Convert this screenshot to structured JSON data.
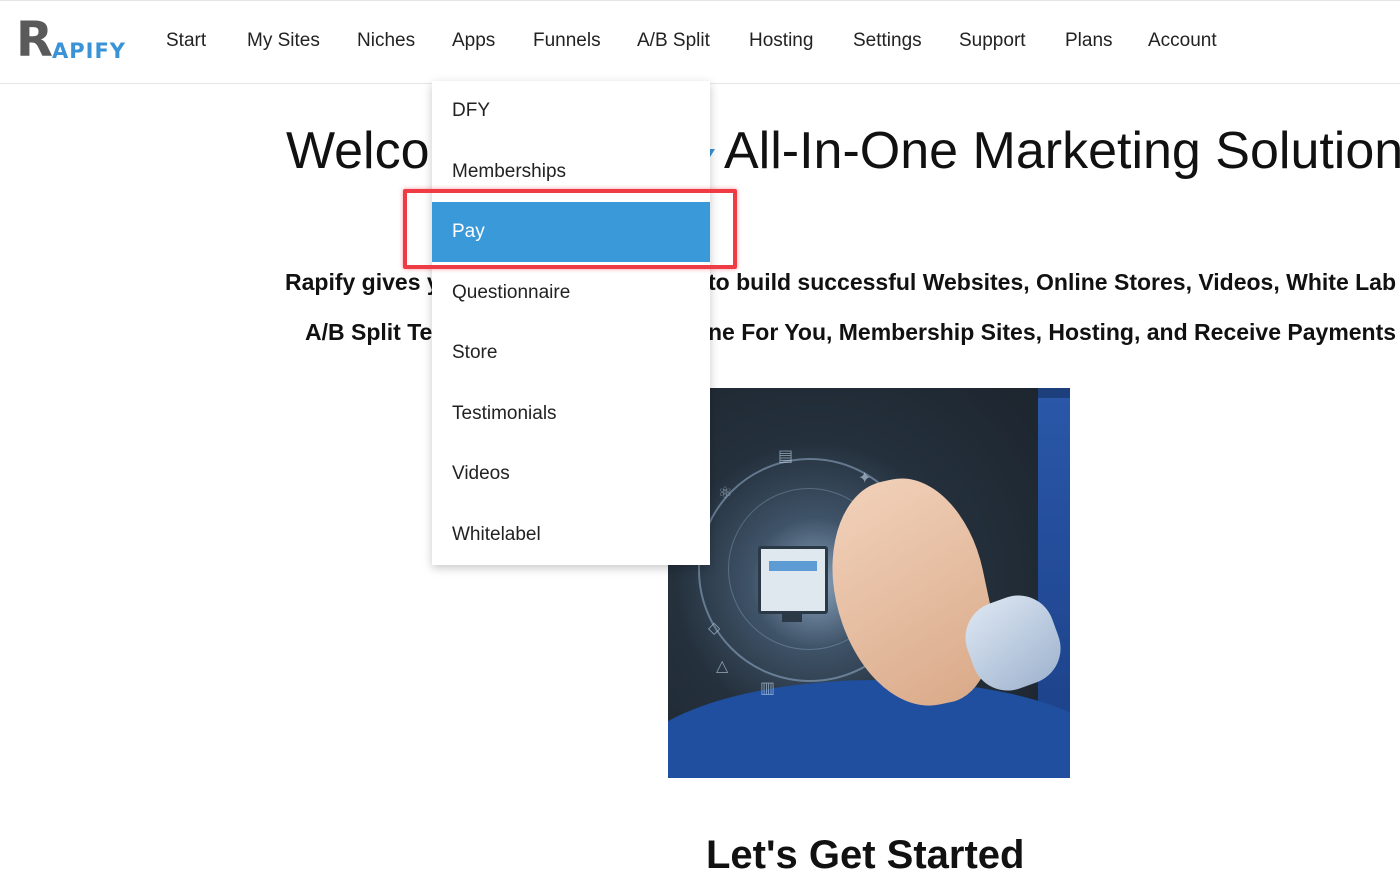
{
  "brand": {
    "logo_initial": "R",
    "logo_rest": "APIFY"
  },
  "nav": {
    "items": [
      "Start",
      "My Sites",
      "Niches",
      "Apps",
      "Funnels",
      "A/B Split",
      "Hosting",
      "Settings",
      "Support",
      "Plans",
      "Account"
    ]
  },
  "hero": {
    "title_left": "Welco",
    "title_right": "All-In-One Marketing Solution",
    "line1_left": "Rapify gives y",
    "line1_right": "to build successful Websites, Online Stores, Videos, White Lab",
    "line2_left": "A/B Split Te",
    "line2_right": "ne For You, Membership Sites, Hosting, and Receive Payments"
  },
  "cta": {
    "heading": "Let's Get Started"
  },
  "apps_menu": {
    "items": [
      "DFY",
      "Memberships",
      "Pay",
      "Questionnaire",
      "Store",
      "Testimonials",
      "Videos",
      "Whitelabel"
    ],
    "active": "Pay"
  },
  "colors": {
    "accent": "#3a99d8",
    "highlight": "#ee3b44",
    "logo_gray": "#5a5a5a"
  }
}
